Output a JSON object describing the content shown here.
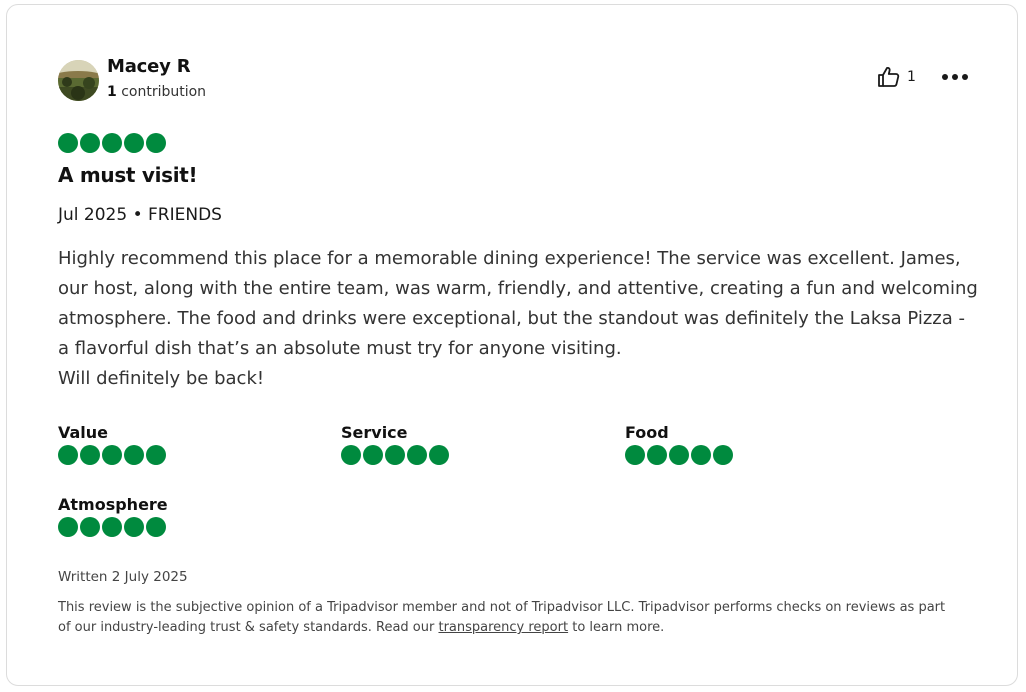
{
  "review": {
    "author": {
      "name": "Macey R",
      "contribution_count": "1",
      "contribution_label": "contribution",
      "avatar_icon": "user-avatar-photo"
    },
    "helpful": {
      "icon": "thumbs-up-icon",
      "count": "1"
    },
    "more_icon": "more-options-icon",
    "rating": 5,
    "rating_max": 5,
    "title": "A must visit!",
    "meta": "Jul 2025 • FRIENDS",
    "body_paragraphs": [
      "Highly recommend this place for a memorable dining experience! The service was excellent. James, our host, along with the entire team, was warm, friendly, and attentive, creating a fun and welcoming atmosphere. The food and drinks were exceptional, but the standout was definitely the Laksa Pizza - a flavorful dish that’s an absolute must try for anyone visiting.",
      "Will definitely be back!"
    ],
    "subratings": [
      {
        "label": "Value",
        "rating": 5
      },
      {
        "label": "Service",
        "rating": 5
      },
      {
        "label": "Food",
        "rating": 5
      },
      {
        "label": "Atmosphere",
        "rating": 5
      }
    ],
    "written": "Written 2 July 2025",
    "disclaimer_before": "This review is the subjective opinion of a Tripadvisor member and not of Tripadvisor LLC. Tripadvisor performs checks on reviews as part of our industry-leading trust & safety standards. Read our ",
    "disclaimer_link": "transparency report",
    "disclaimer_after": " to learn more."
  },
  "colors": {
    "bubble_green": "#008a3e",
    "text_dark": "#111111",
    "border": "#dcdcdc"
  }
}
